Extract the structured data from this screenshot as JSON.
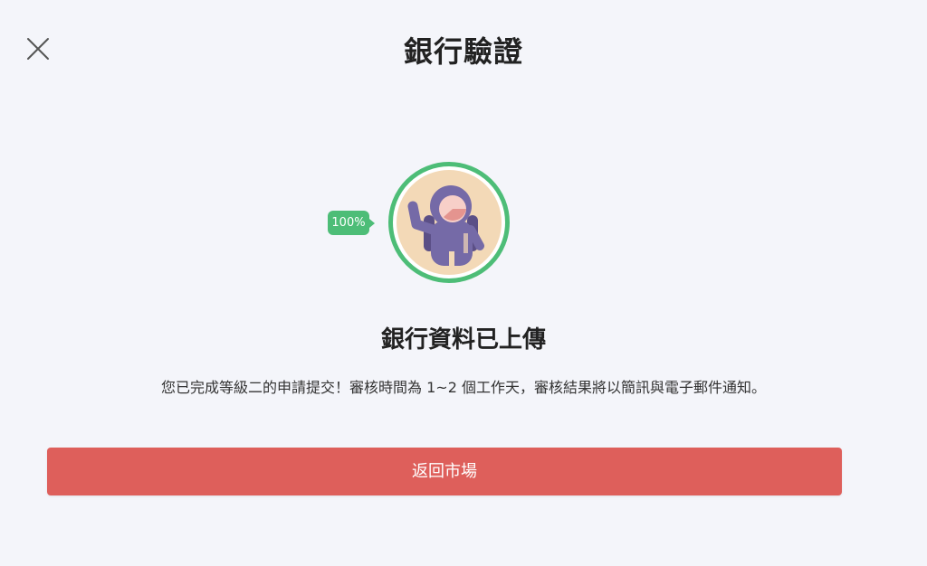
{
  "header": {
    "title": "銀行驗證",
    "close_icon": "close-icon"
  },
  "status": {
    "progress_label": "100%",
    "avatar_icon": "astronaut-avatar-icon",
    "heading": "銀行資料已上傳",
    "description": "您已完成等級二的申請提交！審核時間為 1~2 個工作天，審核結果將以簡訊與電子郵件通知。"
  },
  "actions": {
    "back_label": "返回市場"
  },
  "colors": {
    "accent_green": "#4dbd77",
    "button_red": "#de5f5b",
    "background": "#f4f5fa"
  }
}
